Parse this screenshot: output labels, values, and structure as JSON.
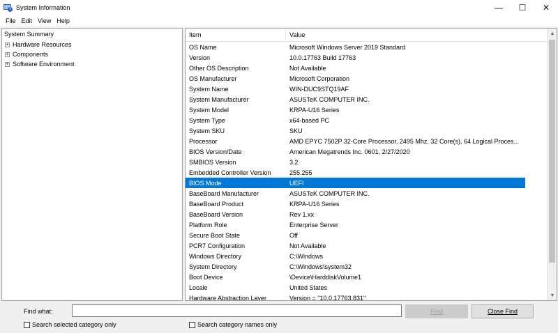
{
  "window": {
    "title": "System Information",
    "controls": {
      "minimize": "—",
      "maximize": "☐",
      "close": "✕"
    }
  },
  "menu": [
    "File",
    "Edit",
    "View",
    "Help"
  ],
  "tree": {
    "root": "System Summary",
    "children": [
      "Hardware Resources",
      "Components",
      "Software Environment"
    ]
  },
  "table": {
    "headers": {
      "item": "Item",
      "value": "Value"
    },
    "selected_item": "BIOS Mode",
    "rows": [
      {
        "item": "OS Name",
        "value": "Microsoft Windows Server 2019 Standard"
      },
      {
        "item": "Version",
        "value": "10.0.17763 Build 17763"
      },
      {
        "item": "Other OS Description",
        "value": "Not Available"
      },
      {
        "item": "OS Manufacturer",
        "value": "Microsoft Corporation"
      },
      {
        "item": "System Name",
        "value": "WIN-DUC9STQ19AF"
      },
      {
        "item": "System Manufacturer",
        "value": "ASUSTeK COMPUTER INC."
      },
      {
        "item": "System Model",
        "value": "KRPA-U16 Series"
      },
      {
        "item": "System Type",
        "value": "x64-based PC"
      },
      {
        "item": "System SKU",
        "value": "SKU"
      },
      {
        "item": "Processor",
        "value": "AMD EPYC 7502P 32-Core Processor, 2495 Mhz, 32 Core(s), 64 Logical Proces..."
      },
      {
        "item": "BIOS Version/Date",
        "value": "American Megatrends Inc. 0601, 2/27/2020"
      },
      {
        "item": "SMBIOS Version",
        "value": "3.2"
      },
      {
        "item": "Embedded Controller Version",
        "value": "255.255"
      },
      {
        "item": "BIOS Mode",
        "value": "UEFI"
      },
      {
        "item": "BaseBoard Manufacturer",
        "value": "ASUSTeK COMPUTER INC."
      },
      {
        "item": "BaseBoard Product",
        "value": "KRPA-U16 Series"
      },
      {
        "item": "BaseBoard Version",
        "value": "Rev 1.xx"
      },
      {
        "item": "Platform Role",
        "value": "Enterprise Server"
      },
      {
        "item": "Secure Boot State",
        "value": "Off"
      },
      {
        "item": "PCR7 Configuration",
        "value": "Not Available"
      },
      {
        "item": "Windows Directory",
        "value": "C:\\Windows"
      },
      {
        "item": "System Directory",
        "value": "C:\\Windows\\system32"
      },
      {
        "item": "Boot Device",
        "value": "\\Device\\HarddiskVolume1"
      },
      {
        "item": "Locale",
        "value": "United States"
      },
      {
        "item": "Hardware Abstraction Layer",
        "value": "Version = \"10.0.17763.831\""
      }
    ]
  },
  "find": {
    "label": "Find what:",
    "value": "",
    "find_button": "Find",
    "close_button": "Close Find",
    "search_selected": "Search selected category only",
    "search_names": "Search category names only"
  },
  "colors": {
    "selection": "#0078d7"
  },
  "icons": {
    "expander": "plus-box-icon",
    "app": "system-information-icon"
  }
}
